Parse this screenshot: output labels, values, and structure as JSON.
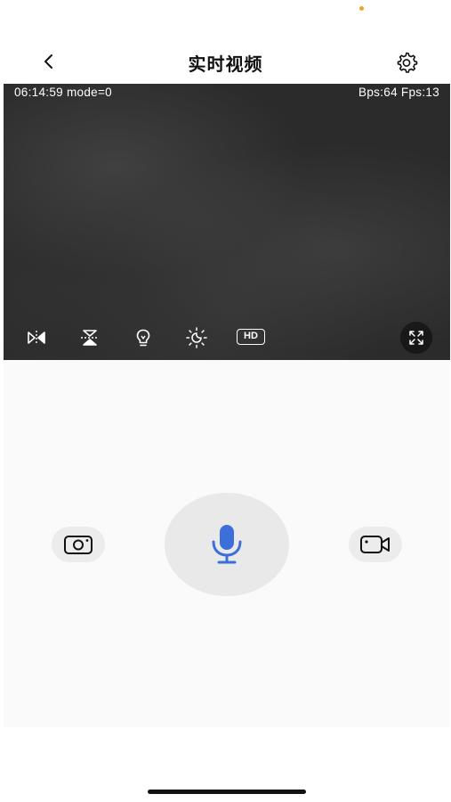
{
  "header": {
    "title": "实时视频",
    "back_icon": "chevron-left-icon",
    "settings_icon": "gear-icon"
  },
  "video": {
    "timestamp_mode": "06:14:59 mode=0",
    "stats": "Bps:64 Fps:13",
    "toolbar": {
      "mirror_icon": "mirror-horizontal-icon",
      "flip_icon": "flip-vertical-icon",
      "light_icon": "lightbulb-icon",
      "night_icon": "day-night-icon",
      "hd_label": "HD",
      "fullscreen_icon": "fullscreen-icon"
    }
  },
  "controls": {
    "snapshot_icon": "camera-icon",
    "talk_icon": "microphone-icon",
    "record_icon": "video-camera-icon"
  },
  "colors": {
    "accent": "#3d6fdb",
    "status_dot": "#f0a030",
    "video_bg": "#2b2b2b"
  }
}
